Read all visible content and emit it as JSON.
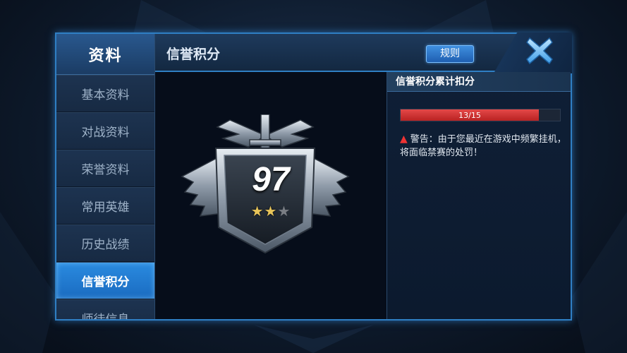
{
  "sidebar": {
    "title": "资料",
    "items": [
      {
        "label": "基本资料",
        "active": false
      },
      {
        "label": "对战资料",
        "active": false
      },
      {
        "label": "荣誉资料",
        "active": false
      },
      {
        "label": "常用英雄",
        "active": false
      },
      {
        "label": "历史战绩",
        "active": false
      },
      {
        "label": "信誉积分",
        "active": true
      },
      {
        "label": "师徒信息",
        "active": false
      }
    ]
  },
  "header": {
    "title": "信誉积分",
    "rules_label": "规则",
    "close_icon": "close-x-icon"
  },
  "emblem": {
    "score": "97",
    "stars_total": 3,
    "stars_lit": 2,
    "icon": "credit-badge-icon"
  },
  "info": {
    "title": "信誉积分累计扣分",
    "progress_text": "13/15",
    "progress_value": 13,
    "progress_max": 15,
    "warning_icon": "warning-triangle-icon",
    "warning_text": "警告：由于您最近在游戏中频繁挂机，将面临禁赛的处罚！"
  },
  "colors": {
    "accent": "#2f7fc4",
    "active_tab": "#2a8be0",
    "progress_fill": "#d63a3a",
    "star_lit": "#e8c55a"
  }
}
